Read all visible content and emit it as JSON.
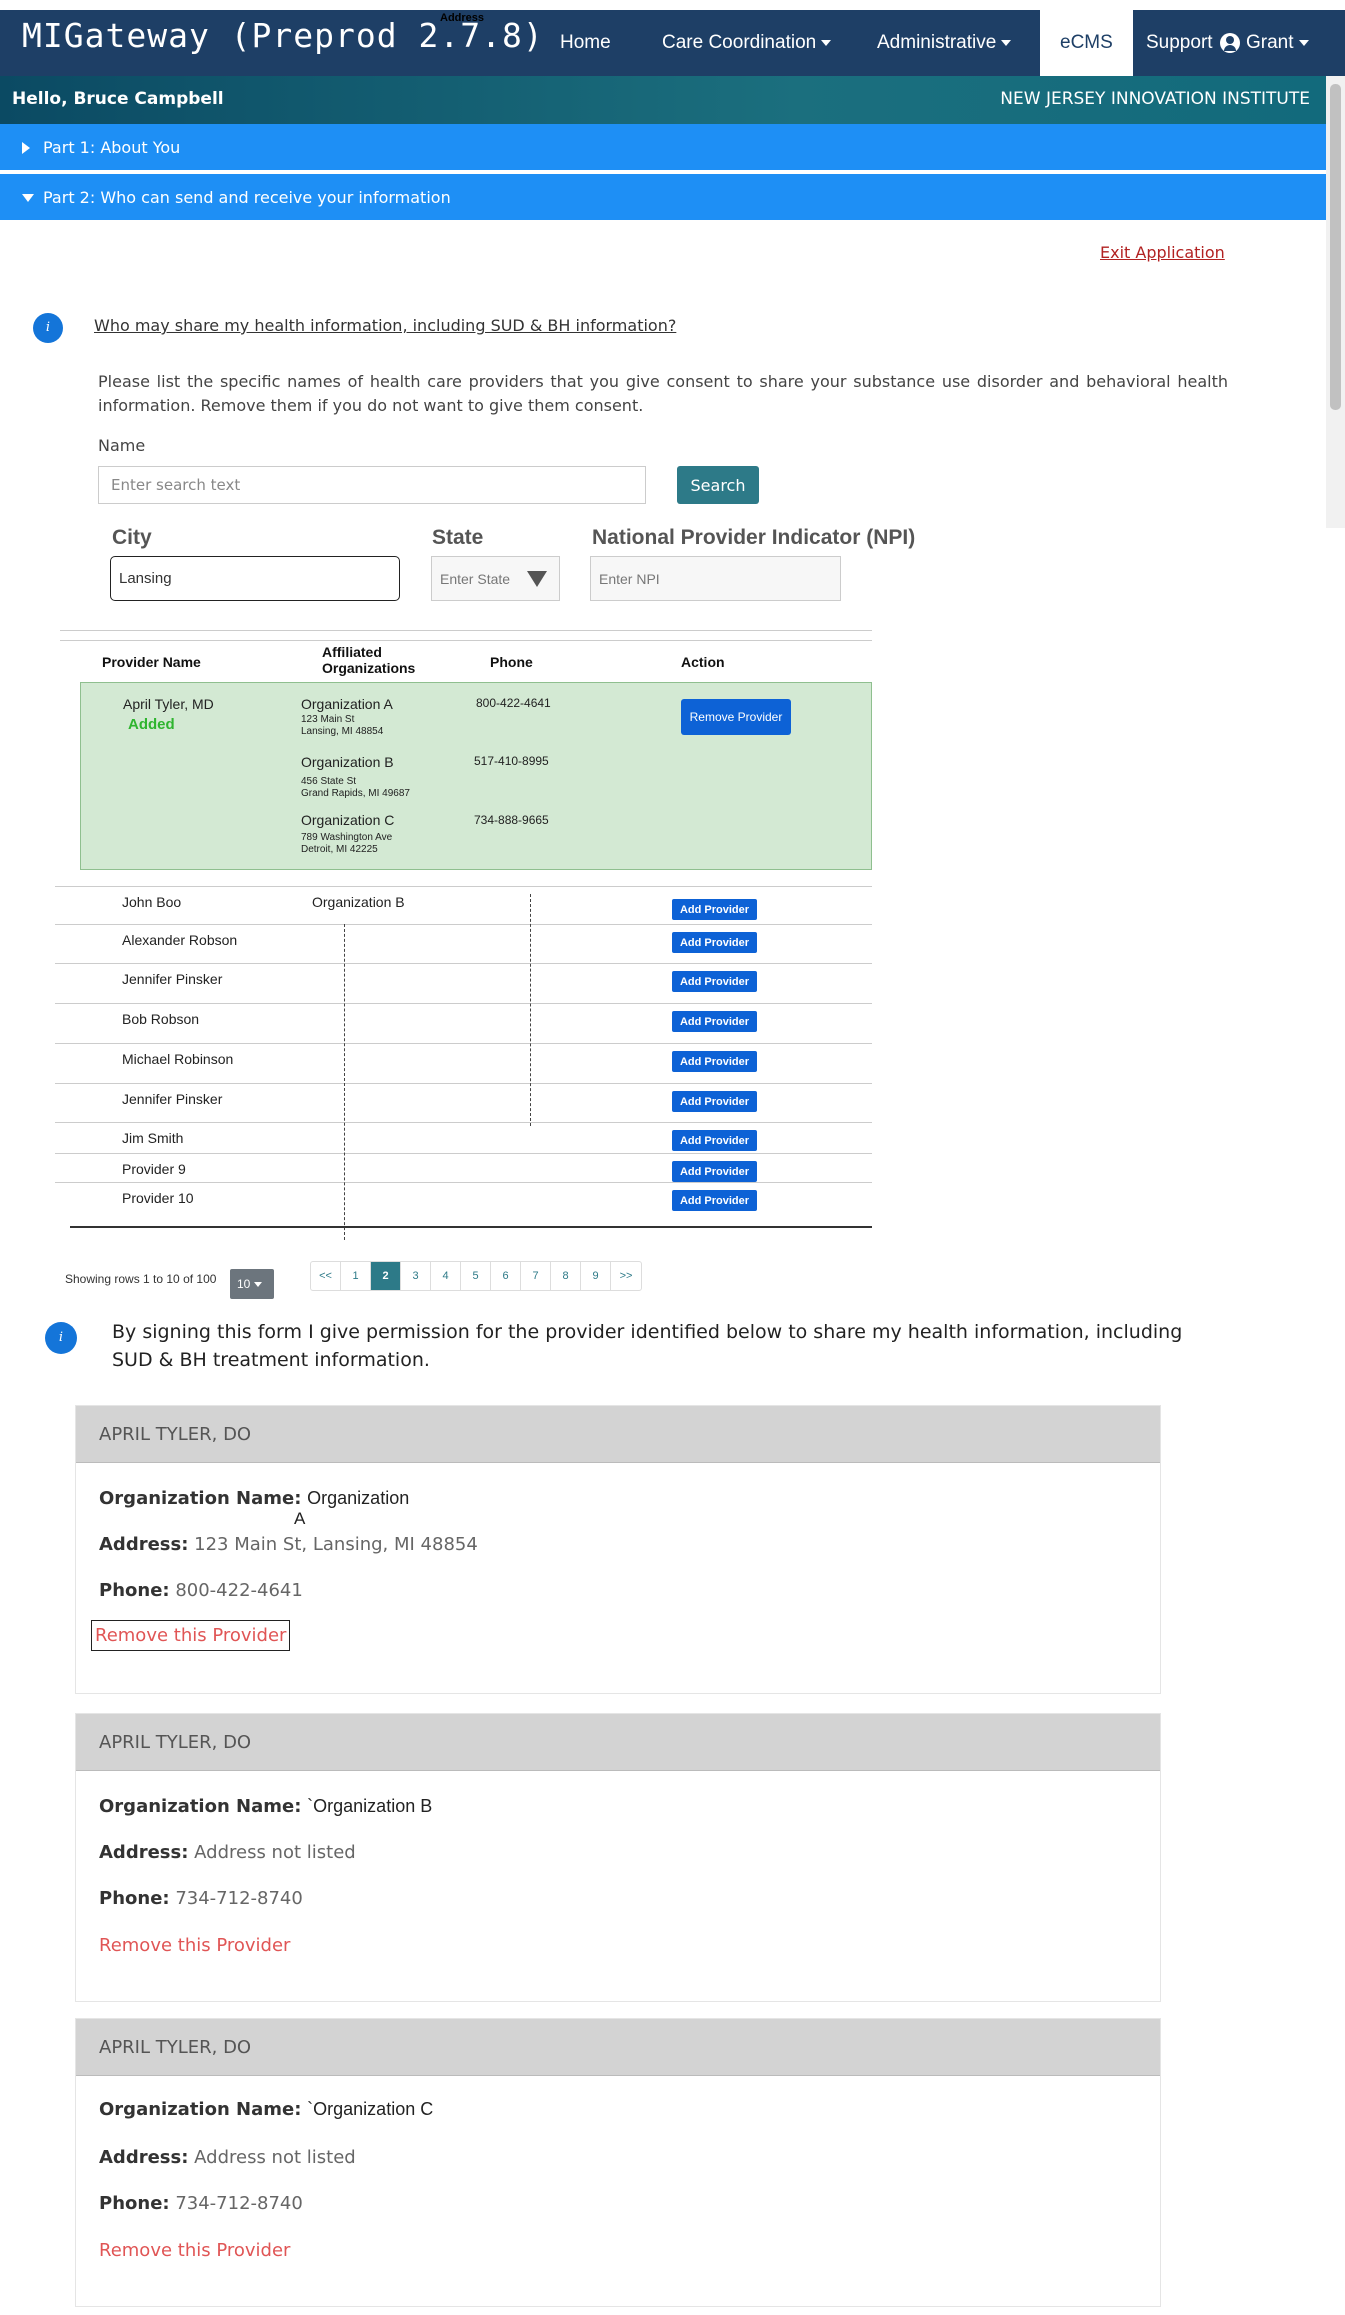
{
  "nav": {
    "brand": "MIGateway (Preprod 2.7.8)",
    "brand_note": "Address",
    "home": "Home",
    "care_coordination": "Care Coordination",
    "administrative": "Administrative",
    "ecms": "eCMS",
    "support": "Support",
    "user": "Grant"
  },
  "greeting": {
    "hello": "Hello, Bruce Campbell",
    "org": "NEW JERSEY INNOVATION INSTITUTE"
  },
  "accordion": {
    "part1": "Part 1: About You",
    "part2": "Part 2: Who can send and receive your information"
  },
  "exit_link": "Exit Application",
  "question_link": "Who may share my health information, including SUD & BH information?",
  "instructions": "Please list the specific names of health care providers that you give consent to share your substance use disorder and behavioral health information. Remove them if you do not want to give them consent.",
  "search": {
    "name_label": "Name",
    "placeholder": "Enter search text",
    "button": "Search",
    "city_label": "City",
    "city_value": "Lansing",
    "state_label": "State",
    "state_placeholder": "Enter State",
    "npi_label": "National Provider Indicator (NPI)",
    "npi_placeholder": "Enter NPI"
  },
  "table": {
    "headers": {
      "provider": "Provider Name",
      "orgs_line1": "Affiliated",
      "orgs_line2": "Organizations",
      "phone": "Phone",
      "action": "Action"
    },
    "added": {
      "name": "April Tyler, MD",
      "status": "Added",
      "remove_label": "Remove Provider",
      "orgs": [
        {
          "name": "Organization A",
          "addr1": "123 Main St",
          "addr2": "Lansing, MI 48854",
          "phone": "800-422-4641"
        },
        {
          "name": "Organization B",
          "addr1": "456 State St",
          "addr2": "Grand Rapids, MI 49687",
          "phone": "517-410-8995"
        },
        {
          "name": "Organization C",
          "addr1": "789 Washington Ave",
          "addr2": "Detroit, MI 42225",
          "phone": "734-888-9665"
        }
      ]
    },
    "add_label": "Add Provider",
    "rows": [
      {
        "name": "John Boo",
        "org": "Organization B"
      },
      {
        "name": "Alexander Robson",
        "org": ""
      },
      {
        "name": "Jennifer Pinsker",
        "org": ""
      },
      {
        "name": "Bob Robson",
        "org": ""
      },
      {
        "name": "Michael Robinson",
        "org": ""
      },
      {
        "name": "Jennifer Pinsker",
        "org": ""
      },
      {
        "name": "Jim Smith",
        "org": ""
      },
      {
        "name": "Provider 9",
        "org": ""
      },
      {
        "name": "Provider 10",
        "org": ""
      }
    ],
    "showing": "Showing rows 1 to 10 of 100",
    "page_size": "10",
    "pages": [
      "<<",
      "1",
      "2",
      "3",
      "4",
      "5",
      "6",
      "7",
      "8",
      "9",
      ">>"
    ],
    "current_page": "2"
  },
  "consent_text": "By signing this form I give permission for the provider identified below to share my health information, including SUD & BH treatment information.",
  "cards": [
    {
      "header": "APRIL TYLER, DO",
      "org_label": "Organization Name:",
      "org_line1": "Organization",
      "org_line2": "A",
      "addr_label": "Address:",
      "addr": "123 Main St, Lansing, MI 48854",
      "phone_label": "Phone:",
      "phone": "800-422-4641",
      "remove": "Remove this Provider"
    },
    {
      "header": "APRIL TYLER, DO",
      "org_label": "Organization Name:",
      "org_line1": "`Organization B",
      "org_line2": "",
      "addr_label": "Address:",
      "addr": "Address not listed",
      "phone_label": "Phone:",
      "phone": "734-712-8740",
      "remove": "Remove this Provider"
    },
    {
      "header": "APRIL TYLER, DO",
      "org_label": "Organization Name:",
      "org_line1": "`Organization C",
      "org_line2": "",
      "addr_label": "Address:",
      "addr": "Address not listed",
      "phone_label": "Phone:",
      "phone": "734-712-8740",
      "remove": "Remove this Provider"
    }
  ],
  "colors": {
    "navbar": "#1e3f66",
    "accordion": "#1e8ff5",
    "primary_button": "#0d62d6",
    "search_button": "#2d7a88",
    "added_bg": "#d3e9d3",
    "added_text": "#2fb52f",
    "remove_link": "#e05555"
  },
  "icons": {
    "user": "user-circle-icon",
    "info": "info-icon",
    "dropdown": "caret-down-icon"
  }
}
